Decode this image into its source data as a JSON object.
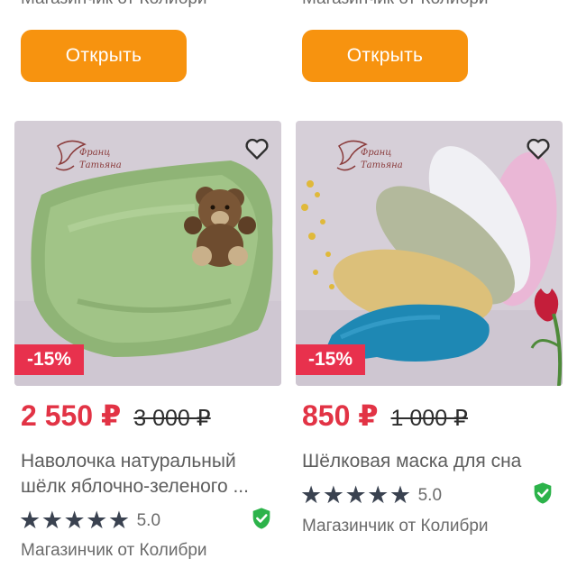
{
  "top_row": {
    "shop_left": "Магазинчик от Колибри",
    "shop_right": "Магазинчик от Колибри",
    "open_label": "Открыть"
  },
  "products": [
    {
      "discount": "-15%",
      "price": "2 550 ₽",
      "old_price": "3 000 ₽",
      "title": "Наволочка натуральный шёлк яблочно-зеленого ...",
      "title_line1": "Наволочка натуральный",
      "title_line2": "шёлк яблочно-зеленого ...",
      "rating": "5.0",
      "stars": 5,
      "shop": "Магазинчик от Колибри",
      "image": "green-silk-pillowcase-with-teddy-bear"
    },
    {
      "discount": "-15%",
      "price": "850 ₽",
      "old_price": "1 000 ₽",
      "title": "Шёлковая маска для сна",
      "rating": "5.0",
      "stars": 5,
      "shop": "Магазинчик от Колибри",
      "image": "colorful-silk-sleep-masks"
    }
  ],
  "icons": {
    "favorite": "heart-outline-icon",
    "star": "star-icon",
    "verified": "shield-check-icon"
  },
  "colors": {
    "accent_button": "#f7930f",
    "price": "#e23345",
    "discount_badge": "#e8314d",
    "verified": "#2cb34a",
    "star": "#3a4250"
  }
}
